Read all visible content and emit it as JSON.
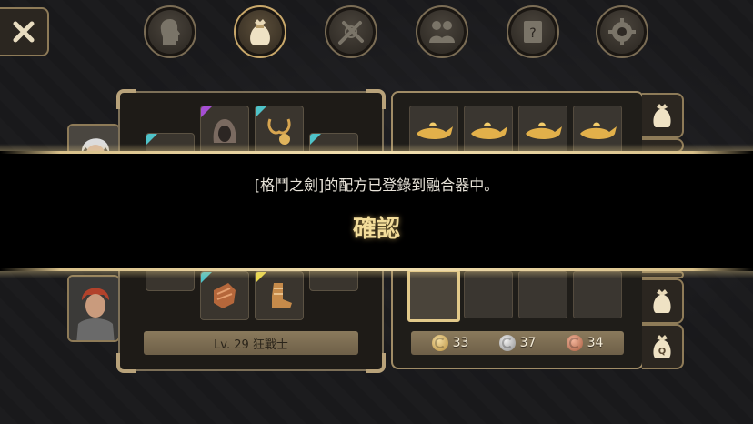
{
  "top_tabs": [
    {
      "icon": "head-profile-icon"
    },
    {
      "icon": "money-bag-icon",
      "active": true
    },
    {
      "icon": "crossed-swords-icon"
    },
    {
      "icon": "party-members-icon"
    },
    {
      "icon": "quest-scroll-icon"
    },
    {
      "icon": "gear-icon"
    }
  ],
  "character": {
    "level_label": "Lv. 29 狂戰士"
  },
  "currency": {
    "gold": "33",
    "silver": "37",
    "bronze": "34"
  },
  "dialog": {
    "message": "[格鬥之劍]的配方已登錄到融合器中。",
    "confirm_label": "確認"
  },
  "colors": {
    "accent_gold": "#d8c08a",
    "confirm_text": "#f3dd9a",
    "panel_border": "#8e7b58"
  }
}
